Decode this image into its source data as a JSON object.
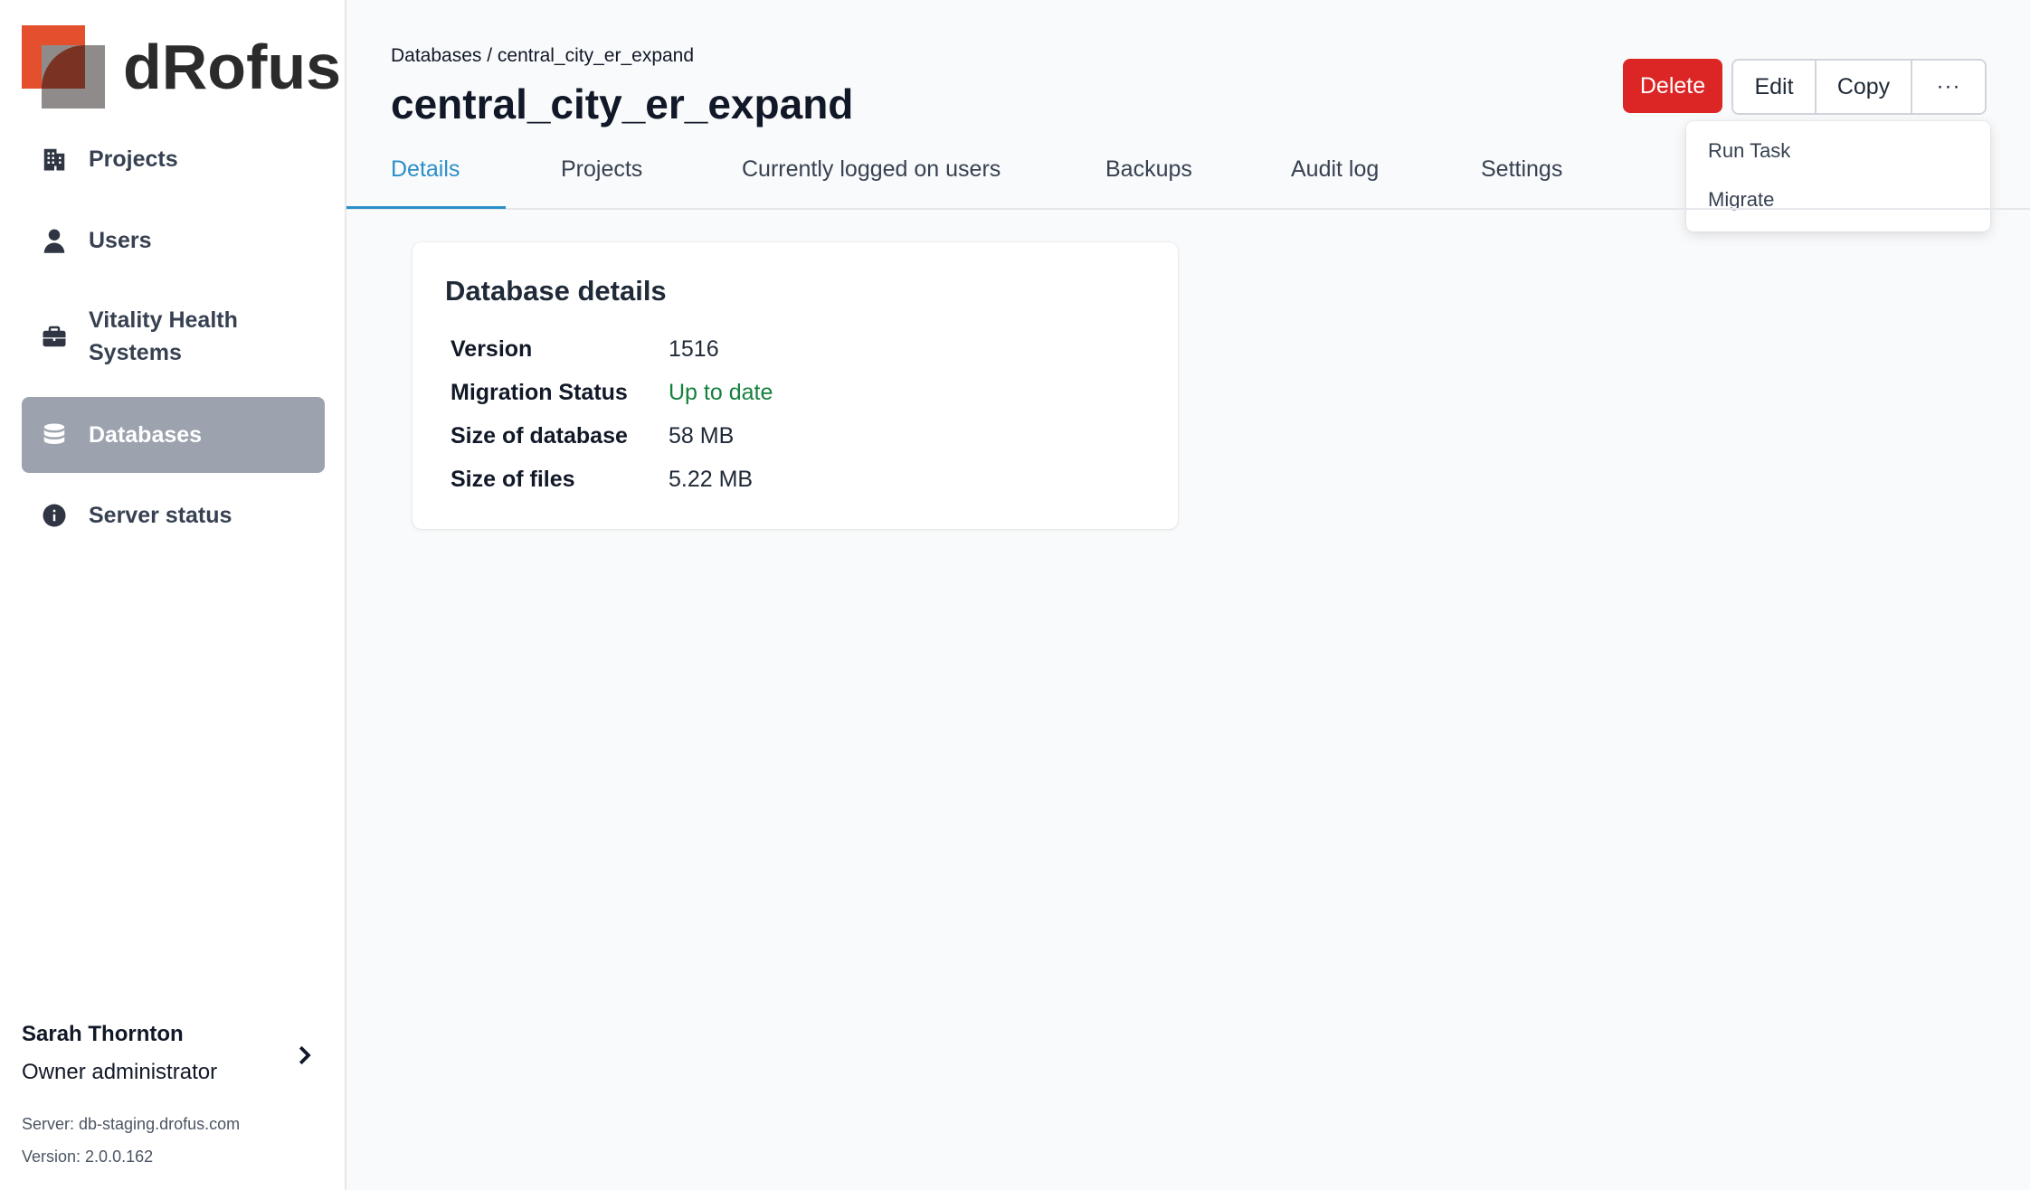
{
  "app": {
    "logo_text": "dRofus"
  },
  "sidebar": {
    "items": [
      {
        "label": "Projects",
        "icon": "building-icon",
        "active": false
      },
      {
        "label": "Users",
        "icon": "user-icon",
        "active": false
      },
      {
        "label": "Vitality Health Systems",
        "icon": "briefcase-icon",
        "active": false
      },
      {
        "label": "Databases",
        "icon": "database-icon",
        "active": true
      },
      {
        "label": "Server status",
        "icon": "info-icon",
        "active": false
      }
    ],
    "user": {
      "name": "Sarah Thornton",
      "role": "Owner administrator"
    },
    "server": "Server: db-staging.drofus.com",
    "version": "Version: 2.0.0.162"
  },
  "header": {
    "breadcrumb": "Databases / central_city_er_expand",
    "title": "central_city_er_expand",
    "actions": {
      "delete": "Delete",
      "edit": "Edit",
      "copy": "Copy",
      "more": "···"
    },
    "more_menu": [
      "Run Task",
      "Migrate"
    ]
  },
  "tabs": [
    {
      "label": "Details",
      "active": true
    },
    {
      "label": "Projects",
      "active": false
    },
    {
      "label": "Currently logged on users",
      "active": false
    },
    {
      "label": "Backups",
      "active": false
    },
    {
      "label": "Audit log",
      "active": false
    },
    {
      "label": "Settings",
      "active": false
    }
  ],
  "details_card": {
    "title": "Database details",
    "rows": [
      {
        "label": "Version",
        "value": "1516"
      },
      {
        "label": "Migration Status",
        "value": "Up to date"
      },
      {
        "label": "Size of database",
        "value": "58 MB"
      },
      {
        "label": "Size of files",
        "value": "5.22 MB"
      }
    ]
  },
  "colors": {
    "accent": "#2b8fc7",
    "danger": "#dc2626",
    "success": "#15803d",
    "active_nav": "#9ca3af",
    "logo_orange": "#e4502e"
  }
}
